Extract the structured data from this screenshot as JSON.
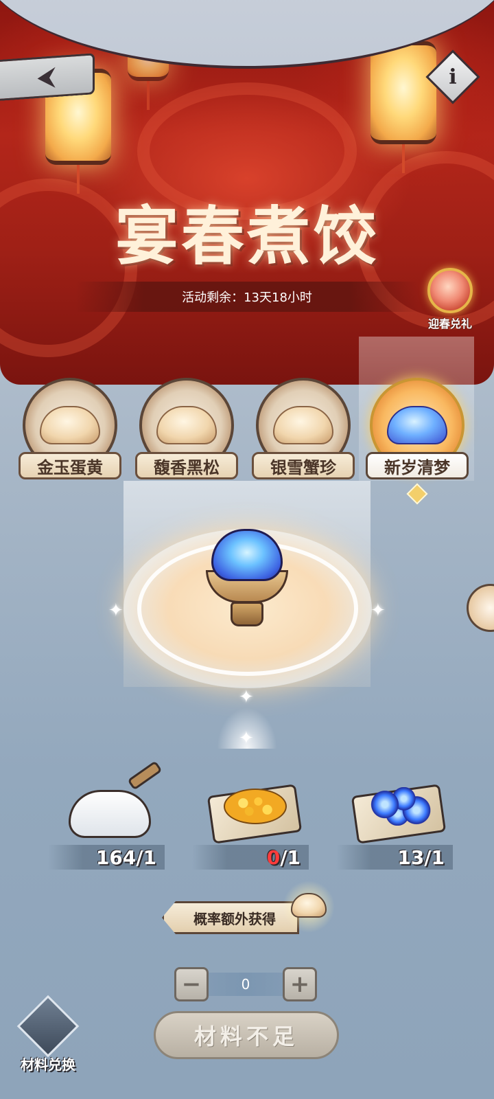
{
  "header": {
    "title": "宴春煮饺",
    "countdown_text": "活动剩余：13天18小时",
    "back_icon": "back-arrow-icon",
    "info_icon": "info-icon",
    "info_glyph": "i",
    "back_glyph": "⮜",
    "gift_label": "迎春兑礼"
  },
  "tabs": [
    {
      "label": "金玉蛋黄",
      "active": false
    },
    {
      "label": "馥香黑松",
      "active": false
    },
    {
      "label": "银雪蟹珍",
      "active": false
    },
    {
      "label": "新岁清梦",
      "active": true
    }
  ],
  "ingredients": [
    {
      "name": "flour",
      "have": "164",
      "need": "/1",
      "short": false
    },
    {
      "name": "osmanthus",
      "have": "0",
      "need": "/1",
      "short": true
    },
    {
      "name": "blue-berries",
      "have": "13",
      "need": "/1",
      "short": false
    }
  ],
  "bonus": {
    "label": "概率额外获得"
  },
  "stepper": {
    "minus": "−",
    "plus": "+",
    "value": "0"
  },
  "confirm_label": "材料不足",
  "exchange_label": "材料兑换",
  "colors": {
    "accent_red": "#b3261a",
    "short_red": "#ff3c3c",
    "gold": "#e6b649"
  }
}
